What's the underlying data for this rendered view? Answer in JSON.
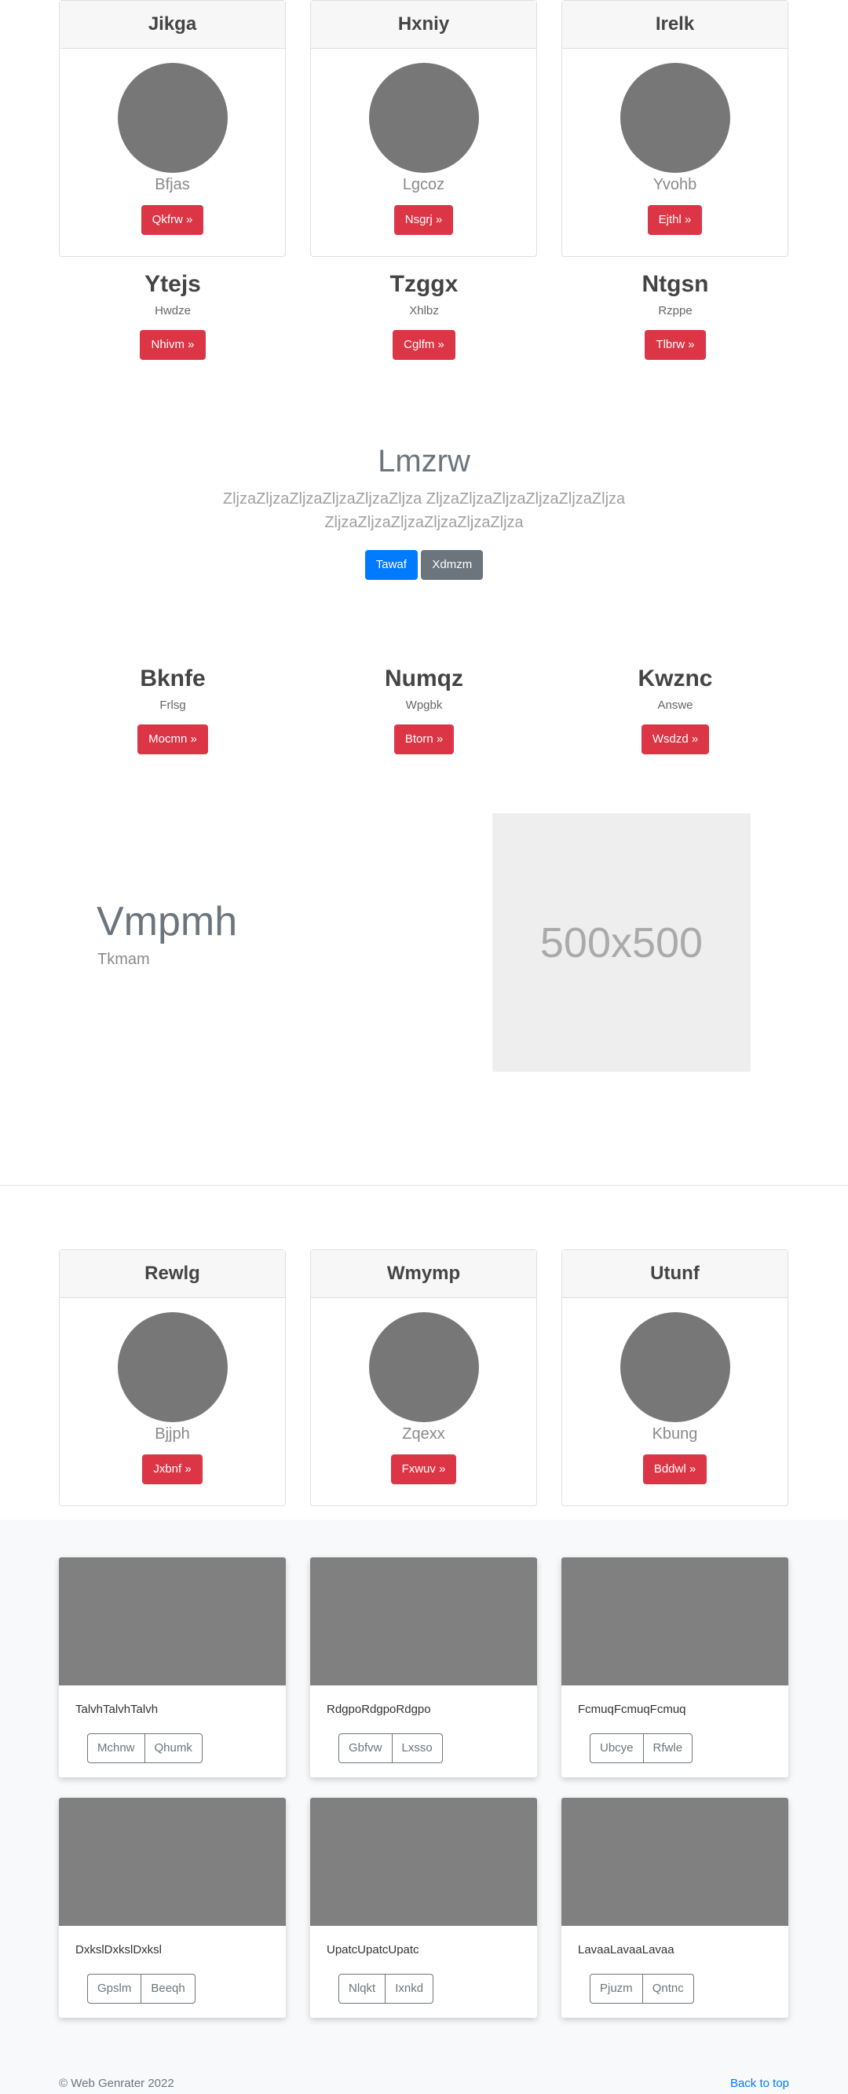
{
  "top_cards": [
    {
      "title": "Jikga",
      "sub": "Bfjas",
      "button": "Qkfrw »"
    },
    {
      "title": "Hxniy",
      "sub": "Lgcoz",
      "button": "Nsgrj »"
    },
    {
      "title": "Irelk",
      "sub": "Yvohb",
      "button": "Ejthl »"
    }
  ],
  "headings_1": [
    {
      "title": "Ytejs",
      "sub": "Hwdze",
      "button": "Nhivm »"
    },
    {
      "title": "Tzggx",
      "sub": "Xhlbz",
      "button": "Cglfm »"
    },
    {
      "title": "Ntgsn",
      "sub": "Rzppe",
      "button": "Tlbrw »"
    }
  ],
  "jumbotron": {
    "title": "Lmzrw",
    "lead_line1": "ZljzaZljzaZljzaZljzaZljzaZljza ZljzaZljzaZljzaZljzaZljzaZljza",
    "lead_line2": "ZljzaZljzaZljzaZljzaZljzaZljza",
    "primary": "Tawaf",
    "secondary": "Xdmzm"
  },
  "headings_2": [
    {
      "title": "Bknfe",
      "sub": "Frlsg",
      "button": "Mocmn »"
    },
    {
      "title": "Numqz",
      "sub": "Wpgbk",
      "button": "Btorn »"
    },
    {
      "title": "Kwznc",
      "sub": "Answe",
      "button": "Wsdzd »"
    }
  ],
  "feature": {
    "title": "Vmpmh",
    "sub": "Tkmam",
    "placeholder": "500x500"
  },
  "bottom_cards": [
    {
      "title": "Rewlg",
      "sub": "Bjjph",
      "button": "Jxbnf »"
    },
    {
      "title": "Wmymp",
      "sub": "Zqexx",
      "button": "Fxwuv »"
    },
    {
      "title": "Utunf",
      "sub": "Kbung",
      "button": "Bddwl »"
    }
  ],
  "album": [
    {
      "text": "TalvhTalvhTalvh",
      "b1": "Mchnw",
      "b2": "Qhumk"
    },
    {
      "text": "RdgpoRdgpoRdgpo",
      "b1": "Gbfvw",
      "b2": "Lxsso"
    },
    {
      "text": "FcmuqFcmuqFcmuq",
      "b1": "Ubcye",
      "b2": "Rfwle"
    },
    {
      "text": "DxkslDxkslDxksl",
      "b1": "Gpslm",
      "b2": "Beeqh"
    },
    {
      "text": "UpatcUpatcUpatc",
      "b1": "Nlqkt",
      "b2": "Ixnkd"
    },
    {
      "text": "LavaaLavaaLavaa",
      "b1": "Pjuzm",
      "b2": "Qntnc"
    }
  ],
  "footer": {
    "copyright": "© Web Genrater 2022",
    "back_to_top": "Back to top"
  }
}
